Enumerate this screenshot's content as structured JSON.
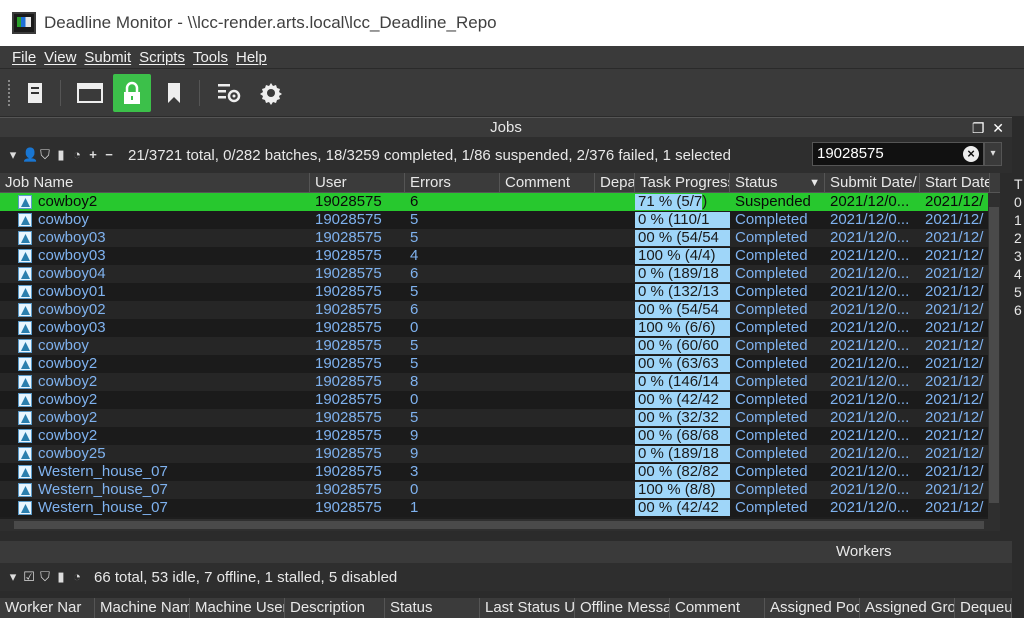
{
  "window": {
    "title": "Deadline Monitor  -  \\\\lcc-render.arts.local\\lcc_Deadline_Repo"
  },
  "menu": [
    "File",
    "View",
    "Submit",
    "Scripts",
    "Tools",
    "Help"
  ],
  "toolbar": {
    "icons": [
      "document-icon",
      "window-icon",
      "lock-icon",
      "bookmark-icon",
      "settings-list-icon",
      "gear-icon"
    ],
    "active": "lock-icon"
  },
  "jobs_panel": {
    "title": "Jobs",
    "summary": "21/3721 total, 0/282 batches, 18/3259 completed, 1/86 suspended, 2/376 failed, 1 selected",
    "search_value": "19028575",
    "columns": [
      "Job Name",
      "User",
      "Errors",
      "Comment",
      "Depa",
      "Task Progress",
      "Status",
      "Submit Date/",
      "Start Date"
    ],
    "rows": [
      {
        "name": "cowboy2",
        "user": "19028575",
        "errors": "6",
        "progress_text": "71 %   (5/7)",
        "progress": 0.71,
        "status": "Suspended",
        "submit": "2021/12/0...",
        "start": "2021/12/"
      },
      {
        "name": "cowboy",
        "user": "19028575",
        "errors": "5",
        "progress_text": "0 %   (110/1",
        "progress": 1.0,
        "status": "Completed",
        "submit": "2021/12/0...",
        "start": "2021/12/"
      },
      {
        "name": "cowboy03",
        "user": "19028575",
        "errors": "5",
        "progress_text": "00 %   (54/54",
        "progress": 1.0,
        "status": "Completed",
        "submit": "2021/12/0...",
        "start": "2021/12/"
      },
      {
        "name": "cowboy03",
        "user": "19028575",
        "errors": "4",
        "progress_text": "100 %   (4/4)",
        "progress": 1.0,
        "status": "Completed",
        "submit": "2021/12/0...",
        "start": "2021/12/"
      },
      {
        "name": "cowboy04",
        "user": "19028575",
        "errors": "6",
        "progress_text": "0 %   (189/18",
        "progress": 1.0,
        "status": "Completed",
        "submit": "2021/12/0...",
        "start": "2021/12/"
      },
      {
        "name": "cowboy01",
        "user": "19028575",
        "errors": "5",
        "progress_text": "0 %   (132/13",
        "progress": 1.0,
        "status": "Completed",
        "submit": "2021/12/0...",
        "start": "2021/12/"
      },
      {
        "name": "cowboy02",
        "user": "19028575",
        "errors": "6",
        "progress_text": "00 %   (54/54",
        "progress": 1.0,
        "status": "Completed",
        "submit": "2021/12/0...",
        "start": "2021/12/"
      },
      {
        "name": "cowboy03",
        "user": "19028575",
        "errors": "0",
        "progress_text": "100 %   (6/6)",
        "progress": 1.0,
        "status": "Completed",
        "submit": "2021/12/0...",
        "start": "2021/12/"
      },
      {
        "name": "cowboy",
        "user": "19028575",
        "errors": "5",
        "progress_text": "00 %   (60/60",
        "progress": 1.0,
        "status": "Completed",
        "submit": "2021/12/0...",
        "start": "2021/12/"
      },
      {
        "name": "cowboy2",
        "user": "19028575",
        "errors": "5",
        "progress_text": "00 %   (63/63",
        "progress": 1.0,
        "status": "Completed",
        "submit": "2021/12/0...",
        "start": "2021/12/"
      },
      {
        "name": "cowboy2",
        "user": "19028575",
        "errors": "8",
        "progress_text": "0 %   (146/14",
        "progress": 1.0,
        "status": "Completed",
        "submit": "2021/12/0...",
        "start": "2021/12/"
      },
      {
        "name": "cowboy2",
        "user": "19028575",
        "errors": "0",
        "progress_text": "00 %   (42/42",
        "progress": 1.0,
        "status": "Completed",
        "submit": "2021/12/0...",
        "start": "2021/12/"
      },
      {
        "name": "cowboy2",
        "user": "19028575",
        "errors": "5",
        "progress_text": "00 %   (32/32",
        "progress": 1.0,
        "status": "Completed",
        "submit": "2021/12/0...",
        "start": "2021/12/"
      },
      {
        "name": "cowboy2",
        "user": "19028575",
        "errors": "9",
        "progress_text": "00 %   (68/68",
        "progress": 1.0,
        "status": "Completed",
        "submit": "2021/12/0...",
        "start": "2021/12/"
      },
      {
        "name": "cowboy25",
        "user": "19028575",
        "errors": "9",
        "progress_text": "0 %   (189/18",
        "progress": 1.0,
        "status": "Completed",
        "submit": "2021/12/0...",
        "start": "2021/12/"
      },
      {
        "name": "Western_house_07",
        "user": "19028575",
        "errors": "3",
        "progress_text": "00 %   (82/82",
        "progress": 1.0,
        "status": "Completed",
        "submit": "2021/12/0...",
        "start": "2021/12/"
      },
      {
        "name": "Western_house_07",
        "user": "19028575",
        "errors": "0",
        "progress_text": "100 %   (8/8)",
        "progress": 1.0,
        "status": "Completed",
        "submit": "2021/12/0...",
        "start": "2021/12/"
      },
      {
        "name": "Western_house_07",
        "user": "19028575",
        "errors": "1",
        "progress_text": "00 %   (42/42",
        "progress": 1.0,
        "status": "Completed",
        "submit": "2021/12/0...",
        "start": "2021/12/"
      }
    ],
    "right_strip_values": [
      "T",
      "0",
      "1",
      "2",
      "3",
      "4",
      "5",
      "6"
    ]
  },
  "workers_panel": {
    "title": "Workers",
    "summary": "66 total, 53 idle, 7 offline, 1 stalled, 5 disabled",
    "columns": [
      "Worker Nar",
      "Machine Nam",
      "Machine User",
      "Description",
      "Status",
      "Last Status Up",
      "Offline Messa",
      "Comment",
      "Assigned Poo",
      "Assigned Gro",
      "Dequeuin"
    ]
  },
  "colors": {
    "selected_row": "#27c82e",
    "link_text": "#7fb2ef",
    "progress_fill": "#9fd6f9",
    "active_toolbar": "#3cc04a"
  }
}
